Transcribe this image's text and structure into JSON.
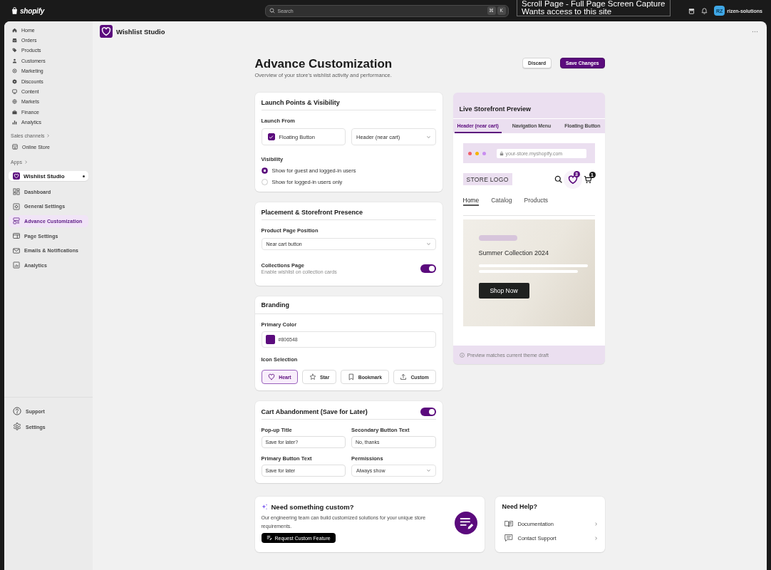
{
  "top_bar": {
    "brand": "shopify",
    "search": {
      "placeholder": "Search",
      "shortcut": [
        "⌘",
        "K"
      ]
    },
    "account": {
      "initials": "RZ",
      "name": "rizen-solutions"
    }
  },
  "extension_popup": {
    "title": "Scroll Page - Full Page Screen Capture",
    "message": "Wants access to this site"
  },
  "sidebar": {
    "items": [
      {
        "label": "Home"
      },
      {
        "label": "Orders"
      },
      {
        "label": "Products"
      },
      {
        "label": "Customers"
      },
      {
        "label": "Marketing"
      },
      {
        "label": "Discounts"
      },
      {
        "label": "Content"
      },
      {
        "label": "Markets"
      },
      {
        "label": "Finance"
      },
      {
        "label": "Analytics"
      }
    ],
    "sales_channels": {
      "heading": "Sales channels",
      "items": [
        {
          "label": "Online Store"
        }
      ]
    },
    "apps": {
      "heading": "Apps",
      "app": {
        "name": "Wishlist Studio",
        "items": [
          {
            "label": "Dashboard",
            "selected": false
          },
          {
            "label": "General Settings",
            "selected": false
          },
          {
            "label": "Advance Customization",
            "selected": true
          },
          {
            "label": "Page Settings",
            "selected": false
          },
          {
            "label": "Emails & Notifications",
            "selected": false
          },
          {
            "label": "Analytics",
            "selected": false
          }
        ]
      }
    },
    "footer_items": [
      {
        "label": "Support"
      },
      {
        "label": "Settings"
      }
    ]
  },
  "app_header": {
    "title": "Wishlist Studio"
  },
  "page": {
    "title": "Advance Customization",
    "subtitle": "Overview of your store's wishlist activity and performance.",
    "actions": [
      {
        "label": "Discard",
        "kind": "secondary"
      },
      {
        "label": "Save Changes",
        "kind": "primary"
      }
    ]
  },
  "launch_card": {
    "title": "Launch Points & Visibility",
    "launch_from": {
      "label": "Launch From",
      "checkbox": {
        "label": "Floating Button",
        "checked": true
      },
      "select": {
        "value": "Header (near cart)"
      }
    },
    "visibility": {
      "label": "Visibility",
      "options": [
        {
          "label": "Show for guest and logged-in users",
          "selected": true
        },
        {
          "label": "Show for logged-in users only",
          "selected": false
        }
      ]
    }
  },
  "placement_card": {
    "title": "Placement & Storefront Presence",
    "product_page_position": {
      "label": "Product Page Position",
      "value": "Near cart button"
    },
    "collections_page": {
      "label": "Collections Page",
      "description": "Enable wishlist on collection cards",
      "on": true
    }
  },
  "branding_card": {
    "title": "Branding",
    "primary_color": {
      "label": "Primary Color",
      "value": "#806548",
      "color": "#5b0b7d"
    },
    "icon_selection": {
      "label": "Icon Selection",
      "options": [
        {
          "label": "Heart",
          "selected": true
        },
        {
          "label": "Star",
          "selected": false
        },
        {
          "label": "Bookmark",
          "selected": false
        },
        {
          "label": "Custom",
          "selected": false
        }
      ]
    }
  },
  "cart_card": {
    "title": "Cart Abandonment (Save for Later)",
    "on": true,
    "fields": [
      {
        "label": "Pop-up Title",
        "value": "Save for later?",
        "kind": "input"
      },
      {
        "label": "Secondary Button Text",
        "value": "No, thanks",
        "kind": "input"
      },
      {
        "label": "Primary Button Text",
        "value": "Save for later",
        "kind": "input"
      },
      {
        "label": "Permissions",
        "value": "Always show",
        "kind": "select"
      }
    ]
  },
  "preview": {
    "title": "Live Storefront Preview",
    "tabs": [
      {
        "label": "Header (near cart)",
        "selected": true
      },
      {
        "label": "Navigation Menu",
        "selected": false
      },
      {
        "label": "Floating Button",
        "selected": false
      }
    ],
    "url": "your-store.myshopify.com",
    "store_logo": "STORE LOGO",
    "wishlist_count": "3",
    "cart_count": "1",
    "nav": [
      {
        "label": "Home",
        "selected": true
      },
      {
        "label": "Catalog",
        "selected": false
      },
      {
        "label": "Products",
        "selected": false
      }
    ],
    "hero": {
      "title": "Summer Collection 2024",
      "button": "Shop Now"
    },
    "note": "Preview matches current theme draft"
  },
  "custom_card": {
    "title": "Need something custom?",
    "text": "Our engineering team can build customized solutions for your unique store requirements.",
    "button": "Request Custom Feature"
  },
  "help_card": {
    "title": "Need Help?",
    "links": [
      {
        "label": "Documentation"
      },
      {
        "label": "Contact Support"
      }
    ]
  }
}
